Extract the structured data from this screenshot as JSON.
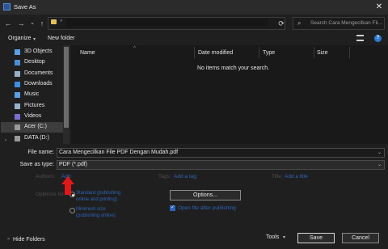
{
  "window": {
    "title": "Save As",
    "close_glyph": "✕"
  },
  "nav": {
    "back": "←",
    "forward": "→",
    "recent": "⌄",
    "up": "↑",
    "refresh": "⟳"
  },
  "search": {
    "placeholder": "Search Cara Mengecilkan Fil...",
    "icon": "search-icon"
  },
  "toolbar": {
    "organize": "Organize",
    "new_folder": "New folder",
    "help": "?"
  },
  "sidebar": {
    "items": [
      {
        "label": "3D Objects",
        "icon": "cube-icon",
        "color": "#5aa0e6"
      },
      {
        "label": "Desktop",
        "icon": "desktop-icon",
        "color": "#4a8fd8"
      },
      {
        "label": "Documents",
        "icon": "documents-icon",
        "color": "#9ab0c8"
      },
      {
        "label": "Downloads",
        "icon": "downloads-icon",
        "color": "#3b8fe0"
      },
      {
        "label": "Music",
        "icon": "music-icon",
        "color": "#5aa0e6"
      },
      {
        "label": "Pictures",
        "icon": "pictures-icon",
        "color": "#9ab0c8"
      },
      {
        "label": "Videos",
        "icon": "videos-icon",
        "color": "#7a6fd0"
      },
      {
        "label": "Acer (C:)",
        "icon": "drive-icon",
        "color": "#9a9a9a"
      },
      {
        "label": "DATA (D:)",
        "icon": "drive-icon",
        "color": "#9a9a9a"
      }
    ]
  },
  "columns": {
    "name": "Name",
    "date_modified": "Date modified",
    "type": "Type",
    "size": "Size"
  },
  "file_list": {
    "empty_message": "No items match your search."
  },
  "form": {
    "file_name_label": "File name:",
    "file_name_value": "Cara Mengecilkan File PDF Dengan Mudah.pdf",
    "save_type_label": "Save as type:",
    "save_type_value": "PDF (*.pdf)",
    "authors_label": "Authors:",
    "authors_link": "Add",
    "tags_label": "Tags:",
    "tags_link": "Add a tag",
    "title_label": "Title:",
    "title_link": "Add a title",
    "optimize_label": "Optimize for:",
    "radio_standard": "Standard (publishing online and printing)",
    "radio_minimum": "Minimum size (publishing online)",
    "options_button": "Options...",
    "open_after_label": "Open file after publishing"
  },
  "footer": {
    "hide_folders": "Hide Folders",
    "tools": "Tools",
    "save": "Save",
    "cancel": "Cancel"
  }
}
